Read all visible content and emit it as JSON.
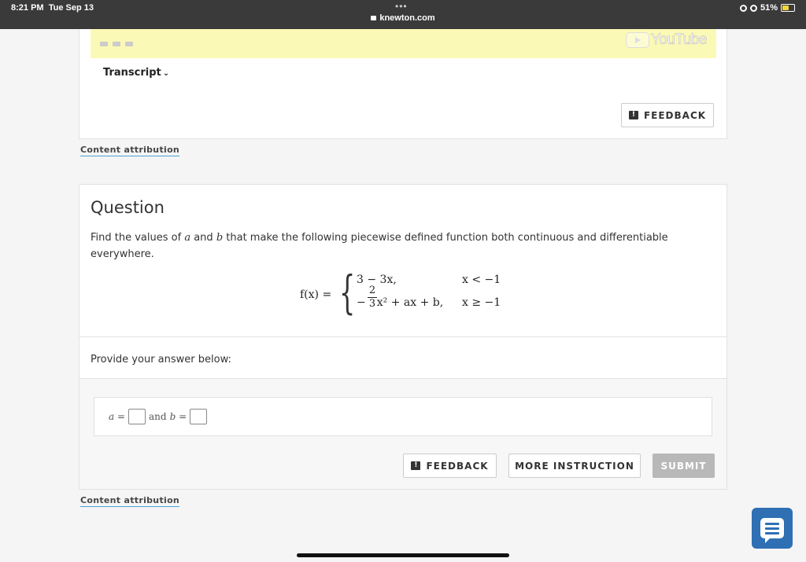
{
  "status_bar": {
    "time": "8:21 PM",
    "date": "Tue Sep 13",
    "dots": "•••",
    "url": "knewton.com",
    "battery": "51%"
  },
  "top_card": {
    "youtube_label": "YouTube",
    "transcript_label": "Transcript",
    "feedback_label": "FEEDBACK"
  },
  "content_attribution": "Content attribution",
  "question": {
    "title": "Question",
    "text_before": "Find the values of ",
    "var_a": "a",
    "text_and": " and ",
    "var_b": "b",
    "text_after": " that make the following piecewise defined function both continuous and differentiable everywhere.",
    "math": {
      "fx": "f(x) =",
      "brace": "{",
      "row1_expr": "3 − 3x,",
      "row1_cond": "x < −1",
      "row2_prefix": "−",
      "frac_num": "2",
      "frac_den": "3",
      "row2_rest": "x² + ax + b,",
      "row2_cond": "x ≥ −1"
    },
    "provide_label": "Provide your answer below:",
    "answer": {
      "a_label": "a =",
      "and_label": "and",
      "b_label": "b ="
    }
  },
  "buttons": {
    "feedback": "FEEDBACK",
    "more_instruction": "MORE INSTRUCTION",
    "submit": "SUBMIT"
  },
  "colors": {
    "accent": "#2f6fb3",
    "video_strip": "#fbf9b6",
    "submit_disabled": "#b8b8b8",
    "link_underline": "#4aa3d9"
  }
}
